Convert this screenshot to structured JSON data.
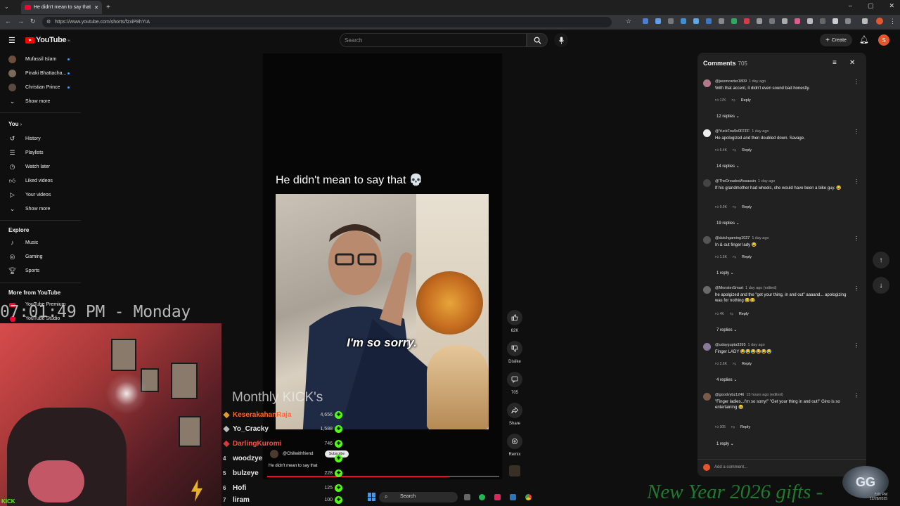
{
  "browser": {
    "tab_title": "He didn't mean to say that",
    "url": "https://www.youtube.com/shorts/fzxiP8hYIA"
  },
  "header": {
    "logo_text": "YouTube",
    "logo_sup": "IN",
    "search_placeholder": "Search",
    "create_label": "Create",
    "avatar_letter": "S"
  },
  "sidebar": {
    "subscriptions": [
      {
        "label": "Mufassil Islam"
      },
      {
        "label": "Pinaki Bhattacha..."
      },
      {
        "label": "Christian Prince"
      },
      {
        "label": "Show more"
      }
    ],
    "you_heading": "You",
    "you_items": [
      {
        "label": "History",
        "icon": "history-icon"
      },
      {
        "label": "Playlists",
        "icon": "playlists-icon"
      },
      {
        "label": "Watch later",
        "icon": "watch-later-icon"
      },
      {
        "label": "Liked videos",
        "icon": "liked-icon"
      },
      {
        "label": "Your videos",
        "icon": "your-videos-icon"
      },
      {
        "label": "Show more",
        "icon": "chevron-down-icon"
      }
    ],
    "explore_heading": "Explore",
    "explore_items": [
      {
        "label": "Music"
      },
      {
        "label": "Gaming"
      },
      {
        "label": "Sports"
      }
    ],
    "more_heading": "More from YouTube",
    "more_items": [
      {
        "label": "YouTube Premium"
      },
      {
        "label": "YouTube Studio"
      }
    ]
  },
  "short": {
    "title": "He didn't mean to say that 💀",
    "caption": "I'm so sorry.",
    "channel": "@Chillwithfriend",
    "subscribe": "Subscribe",
    "bottom_title": "He didn't mean to say that",
    "progress_fraction": 0.78,
    "actions": {
      "like_count": "62K",
      "dislike_label": "Dislike",
      "comment_count": "705",
      "share_label": "Share",
      "remix_label": "Remix"
    }
  },
  "comments": {
    "title": "Comments",
    "count": "705",
    "items": [
      {
        "author": "@jasoncarter1809",
        "time": "1 day ago",
        "text": "With that accent, it didn't even sound bad honestly.",
        "likes": "17K",
        "reply": "Reply",
        "replies": "12 replies"
      },
      {
        "author": "@YuckFou9x0FFFF",
        "time": "1 day ago",
        "text": "He apologized and then doubled down. Savage.",
        "likes": "6.4K",
        "reply": "Reply",
        "replies": "14 replies"
      },
      {
        "author": "@TheDreadedAssassin",
        "time": "1 day ago",
        "text": "If his grandmother had wheels, she would have been a bike guy. 😂",
        "likes": "9.9K",
        "reply": "Reply",
        "replies": "19 replies"
      },
      {
        "author": "@dutchgaming1027",
        "time": "1 day ago",
        "text": "In & out finger lady 😂",
        "likes": "1.5K",
        "reply": "Reply",
        "replies": "1 reply"
      },
      {
        "author": "@MonsterSmart",
        "time": "1 day ago (edited)",
        "text": "he apolgized and the \"get your thing, in and out\" aaaand... apologizing was for nothing 😂😂",
        "likes": "4K",
        "reply": "Reply",
        "replies": "7 replies"
      },
      {
        "author": "@udaygupta3395",
        "time": "1 day ago",
        "text": "Finger LADY 😂😂😂😂😂😂",
        "likes": "2.6K",
        "reply": "Reply",
        "replies": "4 replies"
      },
      {
        "author": "@goodvybz1246",
        "time": "15 hours ago (edited)",
        "text": "\"Finger ladies...I'm so sorry!\" \"Get your thing in and out!\" Gino is so entertaining 😂",
        "likes": "305",
        "reply": "Reply",
        "replies": "1 reply"
      }
    ],
    "add_placeholder": "Add a comment..."
  },
  "overlay": {
    "clock": "07:01:49 PM - Monday",
    "monthly_title": "Monthly KICK's",
    "leaderboard": [
      {
        "rank": "",
        "name": "KeserakahanRaja",
        "value": "4,656",
        "color": "#ff6a2b"
      },
      {
        "rank": "",
        "name": "Yo_Cracky",
        "value": "1,588",
        "color": "#e8e8e8"
      },
      {
        "rank": "",
        "name": "DarlingKuromi",
        "value": "746",
        "color": "#ff4a4a"
      },
      {
        "rank": "4",
        "name": "woodzye",
        "value": "",
        "color": "#e8e8e8"
      },
      {
        "rank": "5",
        "name": "bulzeye",
        "value": "228",
        "color": "#e8e8e8"
      },
      {
        "rank": "6",
        "name": "Hofi",
        "value": "125",
        "color": "#e8e8e8"
      },
      {
        "rank": "7",
        "name": "liram",
        "value": "100",
        "color": "#e8e8e8"
      }
    ],
    "gifts_banner": "New Year 2026 gifts -",
    "kick_logo": "KICK",
    "badge_text": "GG"
  },
  "taskbar": {
    "search": "Search",
    "time": "7:01 PM",
    "date": "12/28/2025"
  }
}
